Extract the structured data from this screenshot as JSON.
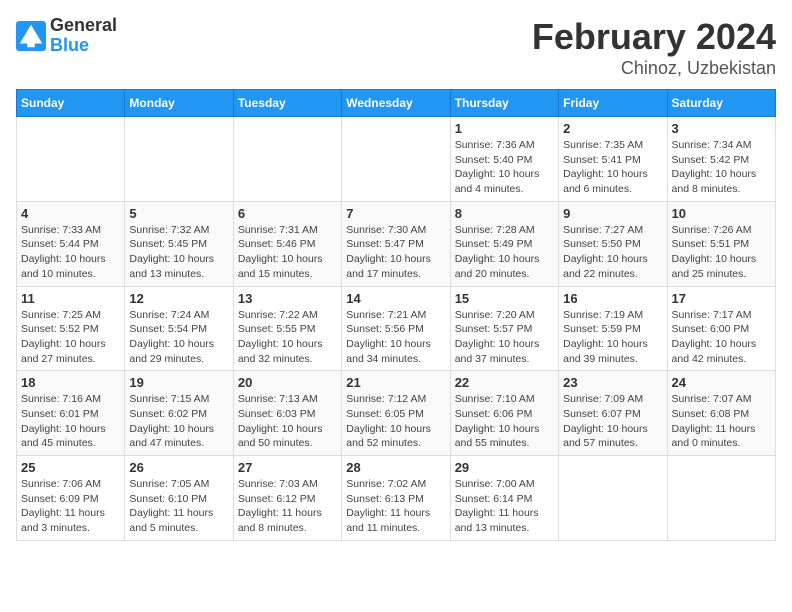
{
  "header": {
    "logo": {
      "general": "General",
      "blue": "Blue"
    },
    "title": "February 2024",
    "subtitle": "Chinoz, Uzbekistan"
  },
  "calendar": {
    "days_of_week": [
      "Sunday",
      "Monday",
      "Tuesday",
      "Wednesday",
      "Thursday",
      "Friday",
      "Saturday"
    ],
    "weeks": [
      [
        {
          "day": "",
          "info": ""
        },
        {
          "day": "",
          "info": ""
        },
        {
          "day": "",
          "info": ""
        },
        {
          "day": "",
          "info": ""
        },
        {
          "day": "1",
          "info": "Sunrise: 7:36 AM\nSunset: 5:40 PM\nDaylight: 10 hours\nand 4 minutes."
        },
        {
          "day": "2",
          "info": "Sunrise: 7:35 AM\nSunset: 5:41 PM\nDaylight: 10 hours\nand 6 minutes."
        },
        {
          "day": "3",
          "info": "Sunrise: 7:34 AM\nSunset: 5:42 PM\nDaylight: 10 hours\nand 8 minutes."
        }
      ],
      [
        {
          "day": "4",
          "info": "Sunrise: 7:33 AM\nSunset: 5:44 PM\nDaylight: 10 hours\nand 10 minutes."
        },
        {
          "day": "5",
          "info": "Sunrise: 7:32 AM\nSunset: 5:45 PM\nDaylight: 10 hours\nand 13 minutes."
        },
        {
          "day": "6",
          "info": "Sunrise: 7:31 AM\nSunset: 5:46 PM\nDaylight: 10 hours\nand 15 minutes."
        },
        {
          "day": "7",
          "info": "Sunrise: 7:30 AM\nSunset: 5:47 PM\nDaylight: 10 hours\nand 17 minutes."
        },
        {
          "day": "8",
          "info": "Sunrise: 7:28 AM\nSunset: 5:49 PM\nDaylight: 10 hours\nand 20 minutes."
        },
        {
          "day": "9",
          "info": "Sunrise: 7:27 AM\nSunset: 5:50 PM\nDaylight: 10 hours\nand 22 minutes."
        },
        {
          "day": "10",
          "info": "Sunrise: 7:26 AM\nSunset: 5:51 PM\nDaylight: 10 hours\nand 25 minutes."
        }
      ],
      [
        {
          "day": "11",
          "info": "Sunrise: 7:25 AM\nSunset: 5:52 PM\nDaylight: 10 hours\nand 27 minutes."
        },
        {
          "day": "12",
          "info": "Sunrise: 7:24 AM\nSunset: 5:54 PM\nDaylight: 10 hours\nand 29 minutes."
        },
        {
          "day": "13",
          "info": "Sunrise: 7:22 AM\nSunset: 5:55 PM\nDaylight: 10 hours\nand 32 minutes."
        },
        {
          "day": "14",
          "info": "Sunrise: 7:21 AM\nSunset: 5:56 PM\nDaylight: 10 hours\nand 34 minutes."
        },
        {
          "day": "15",
          "info": "Sunrise: 7:20 AM\nSunset: 5:57 PM\nDaylight: 10 hours\nand 37 minutes."
        },
        {
          "day": "16",
          "info": "Sunrise: 7:19 AM\nSunset: 5:59 PM\nDaylight: 10 hours\nand 39 minutes."
        },
        {
          "day": "17",
          "info": "Sunrise: 7:17 AM\nSunset: 6:00 PM\nDaylight: 10 hours\nand 42 minutes."
        }
      ],
      [
        {
          "day": "18",
          "info": "Sunrise: 7:16 AM\nSunset: 6:01 PM\nDaylight: 10 hours\nand 45 minutes."
        },
        {
          "day": "19",
          "info": "Sunrise: 7:15 AM\nSunset: 6:02 PM\nDaylight: 10 hours\nand 47 minutes."
        },
        {
          "day": "20",
          "info": "Sunrise: 7:13 AM\nSunset: 6:03 PM\nDaylight: 10 hours\nand 50 minutes."
        },
        {
          "day": "21",
          "info": "Sunrise: 7:12 AM\nSunset: 6:05 PM\nDaylight: 10 hours\nand 52 minutes."
        },
        {
          "day": "22",
          "info": "Sunrise: 7:10 AM\nSunset: 6:06 PM\nDaylight: 10 hours\nand 55 minutes."
        },
        {
          "day": "23",
          "info": "Sunrise: 7:09 AM\nSunset: 6:07 PM\nDaylight: 10 hours\nand 57 minutes."
        },
        {
          "day": "24",
          "info": "Sunrise: 7:07 AM\nSunset: 6:08 PM\nDaylight: 11 hours\nand 0 minutes."
        }
      ],
      [
        {
          "day": "25",
          "info": "Sunrise: 7:06 AM\nSunset: 6:09 PM\nDaylight: 11 hours\nand 3 minutes."
        },
        {
          "day": "26",
          "info": "Sunrise: 7:05 AM\nSunset: 6:10 PM\nDaylight: 11 hours\nand 5 minutes."
        },
        {
          "day": "27",
          "info": "Sunrise: 7:03 AM\nSunset: 6:12 PM\nDaylight: 11 hours\nand 8 minutes."
        },
        {
          "day": "28",
          "info": "Sunrise: 7:02 AM\nSunset: 6:13 PM\nDaylight: 11 hours\nand 11 minutes."
        },
        {
          "day": "29",
          "info": "Sunrise: 7:00 AM\nSunset: 6:14 PM\nDaylight: 11 hours\nand 13 minutes."
        },
        {
          "day": "",
          "info": ""
        },
        {
          "day": "",
          "info": ""
        }
      ]
    ]
  }
}
